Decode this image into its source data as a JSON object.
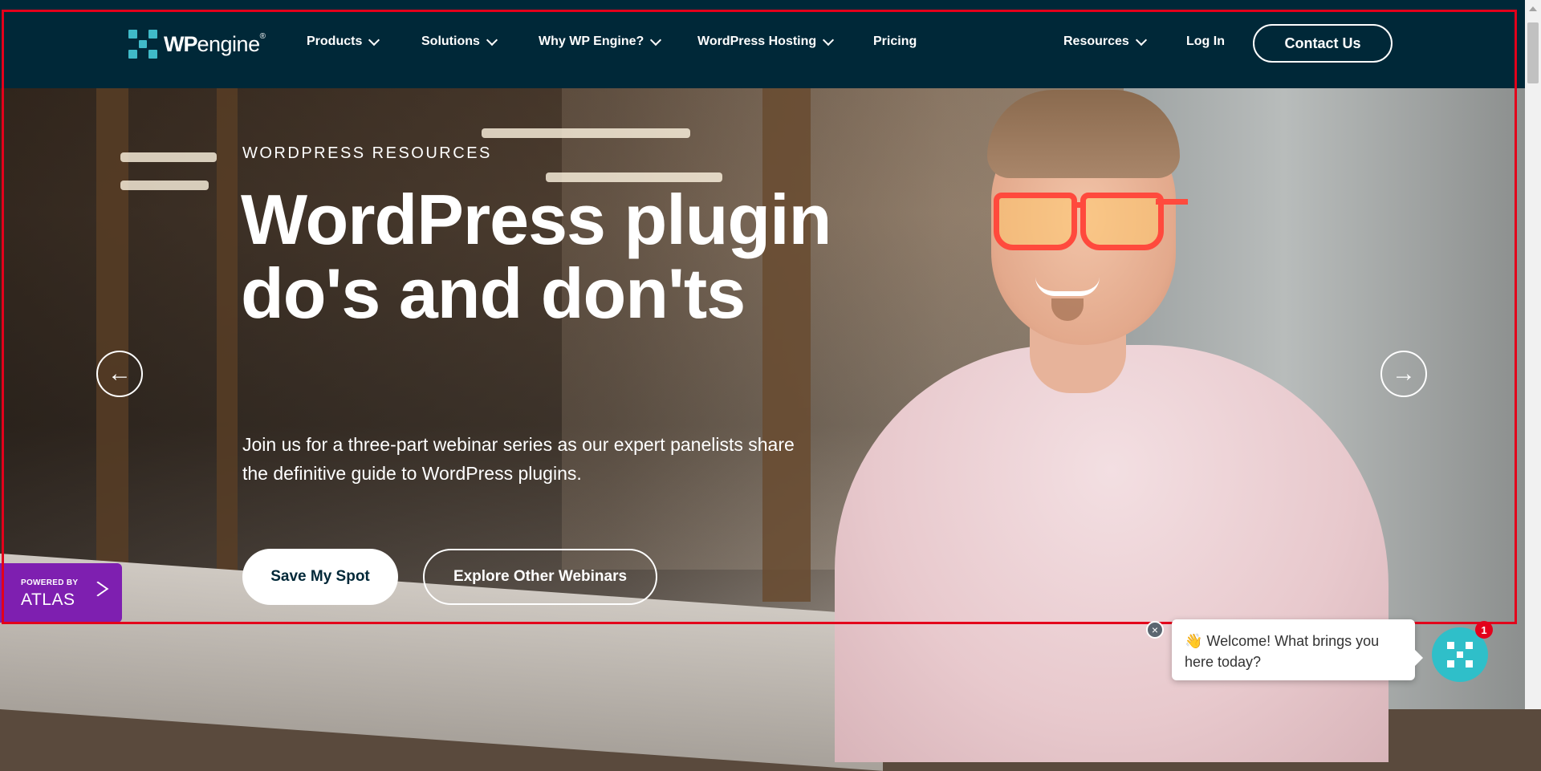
{
  "nav": {
    "logo": {
      "wp": "WP",
      "engine": "engine",
      "reg": "®"
    },
    "items": [
      {
        "label": "Products"
      },
      {
        "label": "Solutions"
      },
      {
        "label": "Why WP Engine?"
      },
      {
        "label": "WordPress Hosting"
      },
      {
        "label": "Pricing"
      }
    ],
    "resources": "Resources",
    "login": "Log In",
    "contact": "Contact Us"
  },
  "hero": {
    "eyebrow": "WORDPRESS RESOURCES",
    "headline": "WordPress plugin do's and don'ts",
    "description": "Join us for a three-part webinar series as our expert panelists share the definitive guide to WordPress plugins.",
    "primary_cta": "Save My Spot",
    "secondary_cta": "Explore Other Webinars",
    "prev_arrow": "←",
    "next_arrow": "→"
  },
  "atlas": {
    "small": "POWERED BY",
    "big": "ATLAS"
  },
  "chat": {
    "message": "👋 Welcome! What brings you here today?",
    "close": "×",
    "badge": "1"
  },
  "colors": {
    "nav_bg": "#002838",
    "brand_teal": "#40bac8",
    "atlas_purple": "#7e1fb0",
    "focus_red": "#e3001b"
  }
}
